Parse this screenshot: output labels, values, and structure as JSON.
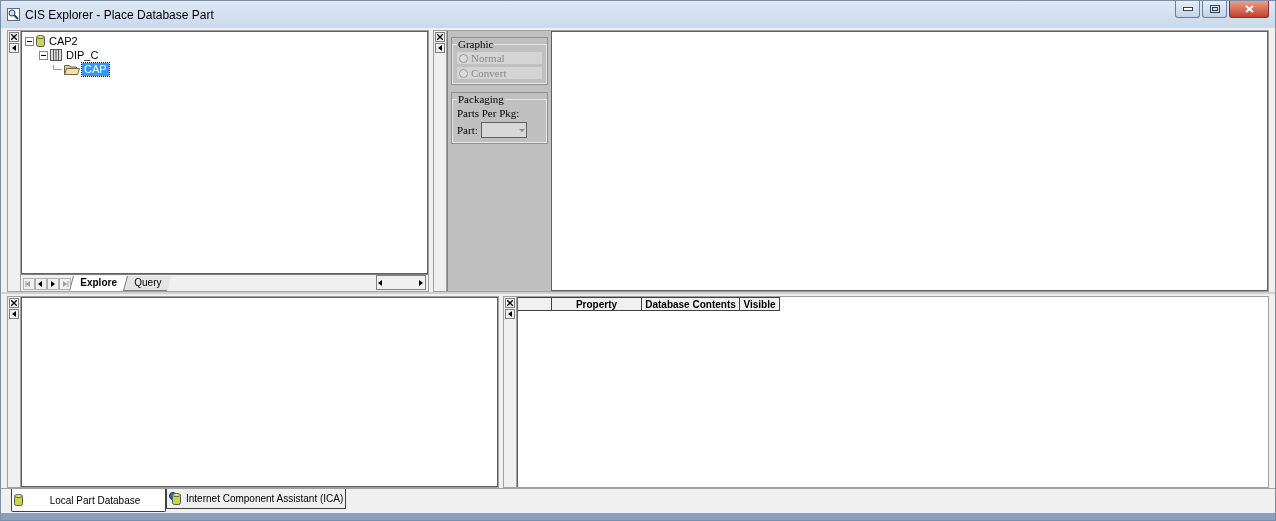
{
  "window": {
    "title": "CIS Explorer - Place Database Part"
  },
  "tree": [
    {
      "label": "CAP2",
      "kind": "database",
      "expanded": true,
      "selected": false,
      "children": [
        {
          "label": "DIP_C",
          "kind": "table",
          "expanded": true,
          "selected": false,
          "children": [
            {
              "label": "CAP",
              "kind": "folder",
              "selected": true
            }
          ]
        }
      ]
    }
  ],
  "explorer_tabs": [
    {
      "label": "Explore",
      "selected": true
    },
    {
      "label": "Query",
      "selected": false
    }
  ],
  "graphic": {
    "title": "Graphic",
    "options": [
      {
        "label": "Normal",
        "checked": false,
        "disabled": true
      },
      {
        "label": "Convert",
        "checked": false,
        "disabled": true
      }
    ]
  },
  "packaging": {
    "title": "Packaging",
    "parts_per_pkg_label": "Parts Per Pkg:",
    "part_label": "Part:"
  },
  "property_grid": {
    "columns": [
      "",
      "Property",
      "Database Contents",
      "Visible"
    ]
  },
  "bottom_tabs": [
    {
      "label": "Local Part Database",
      "selected": true,
      "kind": "local"
    },
    {
      "label": "Internet Component Assistant (ICA)",
      "selected": false,
      "kind": "internet"
    }
  ]
}
